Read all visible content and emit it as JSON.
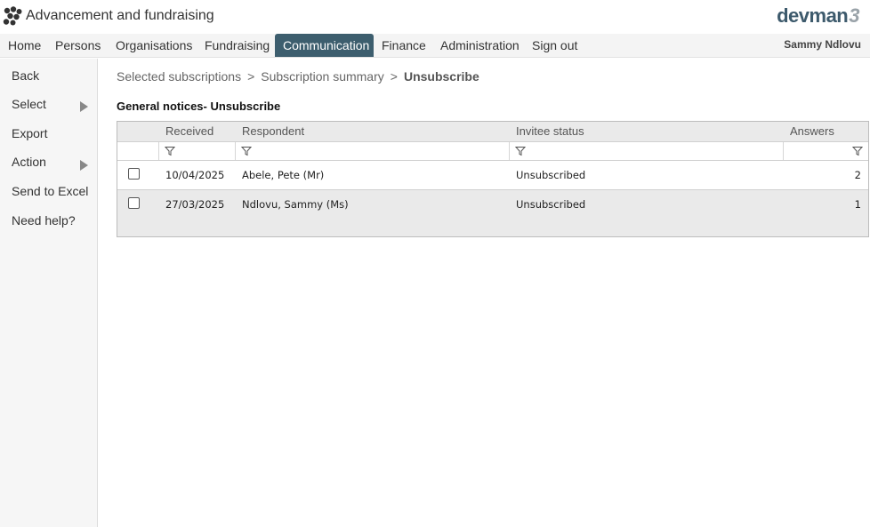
{
  "header": {
    "title": "Advancement and fundraising",
    "brand": "devman",
    "brand_version": "3",
    "logo_icon": "paw-cluster-icon"
  },
  "nav": {
    "items": [
      {
        "label": "Home"
      },
      {
        "label": "Persons"
      },
      {
        "label": "Organisations"
      },
      {
        "label": "Fundraising"
      },
      {
        "label": "Communication",
        "active": true
      },
      {
        "label": "Finance"
      },
      {
        "label": "Administration"
      },
      {
        "label": "Sign out"
      }
    ],
    "user": "Sammy Ndlovu"
  },
  "sidebar": {
    "items": [
      {
        "label": "Back"
      },
      {
        "label": "Select",
        "has_submenu": true
      },
      {
        "label": "Export"
      },
      {
        "label": "Action",
        "has_submenu": true
      },
      {
        "label": "Send to Excel"
      },
      {
        "label": "Need help?"
      }
    ]
  },
  "breadcrumb": {
    "items": [
      "Selected subscriptions",
      "Subscription summary"
    ],
    "separator": ">",
    "current": "Unsubscribe"
  },
  "section": {
    "title": "General notices- Unsubscribe"
  },
  "grid": {
    "columns": [
      "Received",
      "Respondent",
      "Invitee status",
      "Answers"
    ],
    "rows": [
      {
        "received": "10/04/2025",
        "respondent": "Abele, Pete (Mr)",
        "status": "Unsubscribed",
        "answers": "2"
      },
      {
        "received": "27/03/2025",
        "respondent": "Ndlovu, Sammy (Ms)",
        "status": "Unsubscribed",
        "answers": "1"
      }
    ]
  },
  "colors": {
    "nav_active": "#3d5e6e",
    "brand": "#3d5a6c"
  }
}
